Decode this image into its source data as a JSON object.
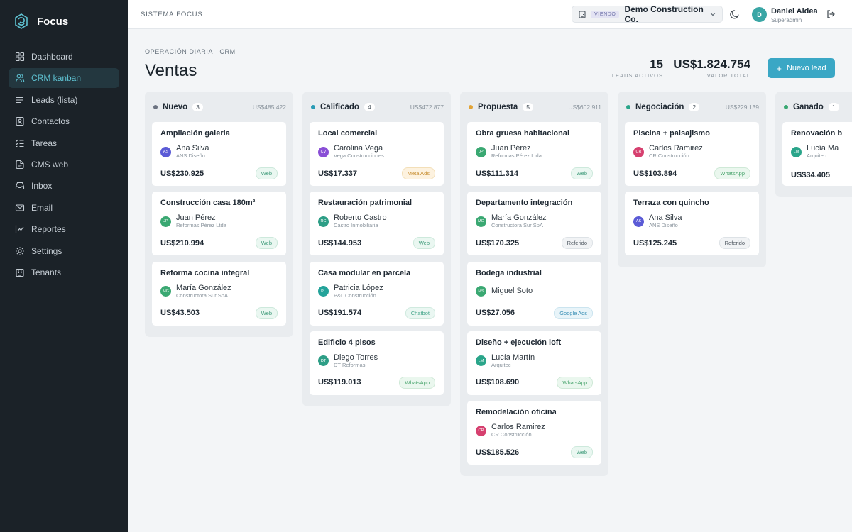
{
  "app": {
    "name": "Focus",
    "system_label": "SISTEMA FOCUS"
  },
  "sidebar": {
    "items": [
      {
        "label": "Dashboard",
        "icon": "grid-icon",
        "active": false
      },
      {
        "label": "CRM kanban",
        "icon": "users-icon",
        "active": true
      },
      {
        "label": "Leads (lista)",
        "icon": "list-icon",
        "active": false
      },
      {
        "label": "Contactos",
        "icon": "contact-card-icon",
        "active": false
      },
      {
        "label": "Tareas",
        "icon": "checklist-icon",
        "active": false
      },
      {
        "label": "CMS web",
        "icon": "globe-icon",
        "active": false
      },
      {
        "label": "Inbox",
        "icon": "inbox-icon",
        "active": false
      },
      {
        "label": "Email",
        "icon": "mail-icon",
        "active": false
      },
      {
        "label": "Reportes",
        "icon": "chart-icon",
        "active": false
      },
      {
        "label": "Settings",
        "icon": "gear-icon",
        "active": false
      },
      {
        "label": "Tenants",
        "icon": "building-icon",
        "active": false
      }
    ]
  },
  "topbar": {
    "viewing_badge": "VIENDO",
    "tenant_name": "Demo Construction Co.",
    "user": {
      "initial": "D",
      "name": "Daniel Aldea",
      "role": "Superadmin"
    }
  },
  "page": {
    "breadcrumb": "OPERACIÓN DIARIA · CRM",
    "title": "Ventas",
    "stats": {
      "leads_value": "15",
      "leads_label": "LEADS ACTIVOS",
      "total_value": "US$1.824.754",
      "total_label": "VALOR TOTAL"
    },
    "new_lead_label": "Nuevo lead"
  },
  "columns": [
    {
      "title": "Nuevo",
      "count": "3",
      "total": "US$485.422",
      "color": "#6b7280",
      "cards": [
        {
          "title": "Ampliación galeria",
          "initials": "AS",
          "avatar_color": "#5b5bd6",
          "contact": "Ana Silva",
          "company": "ANS Diseño",
          "amount": "US$230.925",
          "source": "Web",
          "source_class": "src-web"
        },
        {
          "title": "Construcción casa 180m²",
          "initials": "JP",
          "avatar_color": "#3aa872",
          "contact": "Juan Pérez",
          "company": "Reformas Pérez Ltda",
          "amount": "US$210.994",
          "source": "Web",
          "source_class": "src-web"
        },
        {
          "title": "Reforma cocina integral",
          "initials": "MG",
          "avatar_color": "#3aa872",
          "contact": "María González",
          "company": "Constructora Sur SpA",
          "amount": "US$43.503",
          "source": "Web",
          "source_class": "src-web"
        }
      ]
    },
    {
      "title": "Calificado",
      "count": "4",
      "total": "US$472.877",
      "color": "#2a9bb5",
      "cards": [
        {
          "title": "Local comercial",
          "initials": "CV",
          "avatar_color": "#8a4fd6",
          "contact": "Carolina Vega",
          "company": "Vega Construcciones",
          "amount": "US$17.337",
          "source": "Meta Ads",
          "source_class": "src-meta"
        },
        {
          "title": "Restauración patrimonial",
          "initials": "RC",
          "avatar_color": "#2d9e86",
          "contact": "Roberto Castro",
          "company": "Castro Inmobiliaria",
          "amount": "US$144.953",
          "source": "Web",
          "source_class": "src-web"
        },
        {
          "title": "Casa modular en parcela",
          "initials": "PL",
          "avatar_color": "#23a39a",
          "contact": "Patricia López",
          "company": "P&L Construcción",
          "amount": "US$191.574",
          "source": "Chatbot",
          "source_class": "src-chatbot"
        },
        {
          "title": "Edificio 4 pisos",
          "initials": "DT",
          "avatar_color": "#2d9e86",
          "contact": "Diego Torres",
          "company": "DT Reformas",
          "amount": "US$119.013",
          "source": "WhatsApp",
          "source_class": "src-whatsapp"
        }
      ]
    },
    {
      "title": "Propuesta",
      "count": "5",
      "total": "US$602.911",
      "color": "#e2a336",
      "cards": [
        {
          "title": "Obra gruesa habitacional",
          "initials": "JP",
          "avatar_color": "#3aa872",
          "contact": "Juan Pérez",
          "company": "Reformas Pérez Ltda",
          "amount": "US$111.314",
          "source": "Web",
          "source_class": "src-web"
        },
        {
          "title": "Departamento integración",
          "initials": "MG",
          "avatar_color": "#3aa872",
          "contact": "María González",
          "company": "Constructora Sur SpA",
          "amount": "US$170.325",
          "source": "Referido",
          "source_class": "src-referido"
        },
        {
          "title": "Bodega industrial",
          "initials": "MS",
          "avatar_color": "#3aa872",
          "contact": "Miguel Soto",
          "company": "",
          "amount": "US$27.056",
          "source": "Google Ads",
          "source_class": "src-google"
        },
        {
          "title": "Diseño + ejecución loft",
          "initials": "LM",
          "avatar_color": "#2aa58a",
          "contact": "Lucía Martín",
          "company": "Arquitec",
          "amount": "US$108.690",
          "source": "WhatsApp",
          "source_class": "src-whatsapp"
        },
        {
          "title": "Remodelación oficina",
          "initials": "CR",
          "avatar_color": "#d6406f",
          "contact": "Carlos Ramirez",
          "company": "CR Construcción",
          "amount": "US$185.526",
          "source": "Web",
          "source_class": "src-web"
        }
      ]
    },
    {
      "title": "Negociación",
      "count": "2",
      "total": "US$229.139",
      "color": "#2aa58a",
      "cards": [
        {
          "title": "Piscina + paisajismo",
          "initials": "CR",
          "avatar_color": "#d6406f",
          "contact": "Carlos Ramirez",
          "company": "CR Construcción",
          "amount": "US$103.894",
          "source": "WhatsApp",
          "source_class": "src-whatsapp"
        },
        {
          "title": "Terraza con quincho",
          "initials": "AS",
          "avatar_color": "#5b5bd6",
          "contact": "Ana Silva",
          "company": "ANS Diseño",
          "amount": "US$125.245",
          "source": "Referido",
          "source_class": "src-referido"
        }
      ]
    },
    {
      "title": "Ganado",
      "count": "1",
      "total": "",
      "color": "#3aa872",
      "cards": [
        {
          "title": "Renovación b",
          "initials": "LM",
          "avatar_color": "#2aa58a",
          "contact": "Lucía Ma",
          "company": "Arquitec",
          "amount": "US$34.405",
          "source": "",
          "source_class": "src-web"
        }
      ]
    }
  ]
}
